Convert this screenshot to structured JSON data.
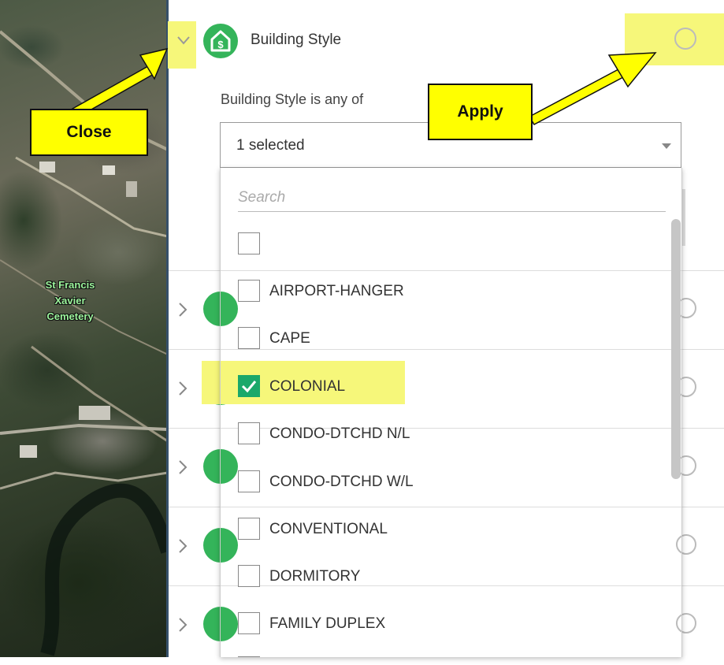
{
  "map": {
    "label_lines": [
      "St Francis",
      "Xavier",
      "Cemetery"
    ]
  },
  "filter": {
    "title": "Building Style",
    "expression_label": "Building Style is any of",
    "select_value": "1 selected",
    "search_placeholder": "Search",
    "options": [
      {
        "label": "",
        "checked": false
      },
      {
        "label": "AIRPORT-HANGER",
        "checked": false
      },
      {
        "label": "CAPE",
        "checked": false
      },
      {
        "label": "COLONIAL",
        "checked": true
      },
      {
        "label": "CONDO-DTCHD N/L",
        "checked": false
      },
      {
        "label": "CONDO-DTCHD W/L",
        "checked": false
      },
      {
        "label": "CONVENTIONAL",
        "checked": false
      },
      {
        "label": "DORMITORY",
        "checked": false
      },
      {
        "label": "FAMILY DUPLEX",
        "checked": false
      }
    ]
  },
  "callouts": {
    "close": "Close",
    "apply": "Apply"
  },
  "colors": {
    "highlight": "#f6f77a",
    "callout": "#ffff00",
    "accent_green": "#34b45a",
    "check_green": "#1aa86a"
  },
  "icons": {
    "building": "building-dollar-icon",
    "collapse": "chevron-down-icon",
    "expand": "chevron-right-icon",
    "apply": "circle-icon"
  }
}
